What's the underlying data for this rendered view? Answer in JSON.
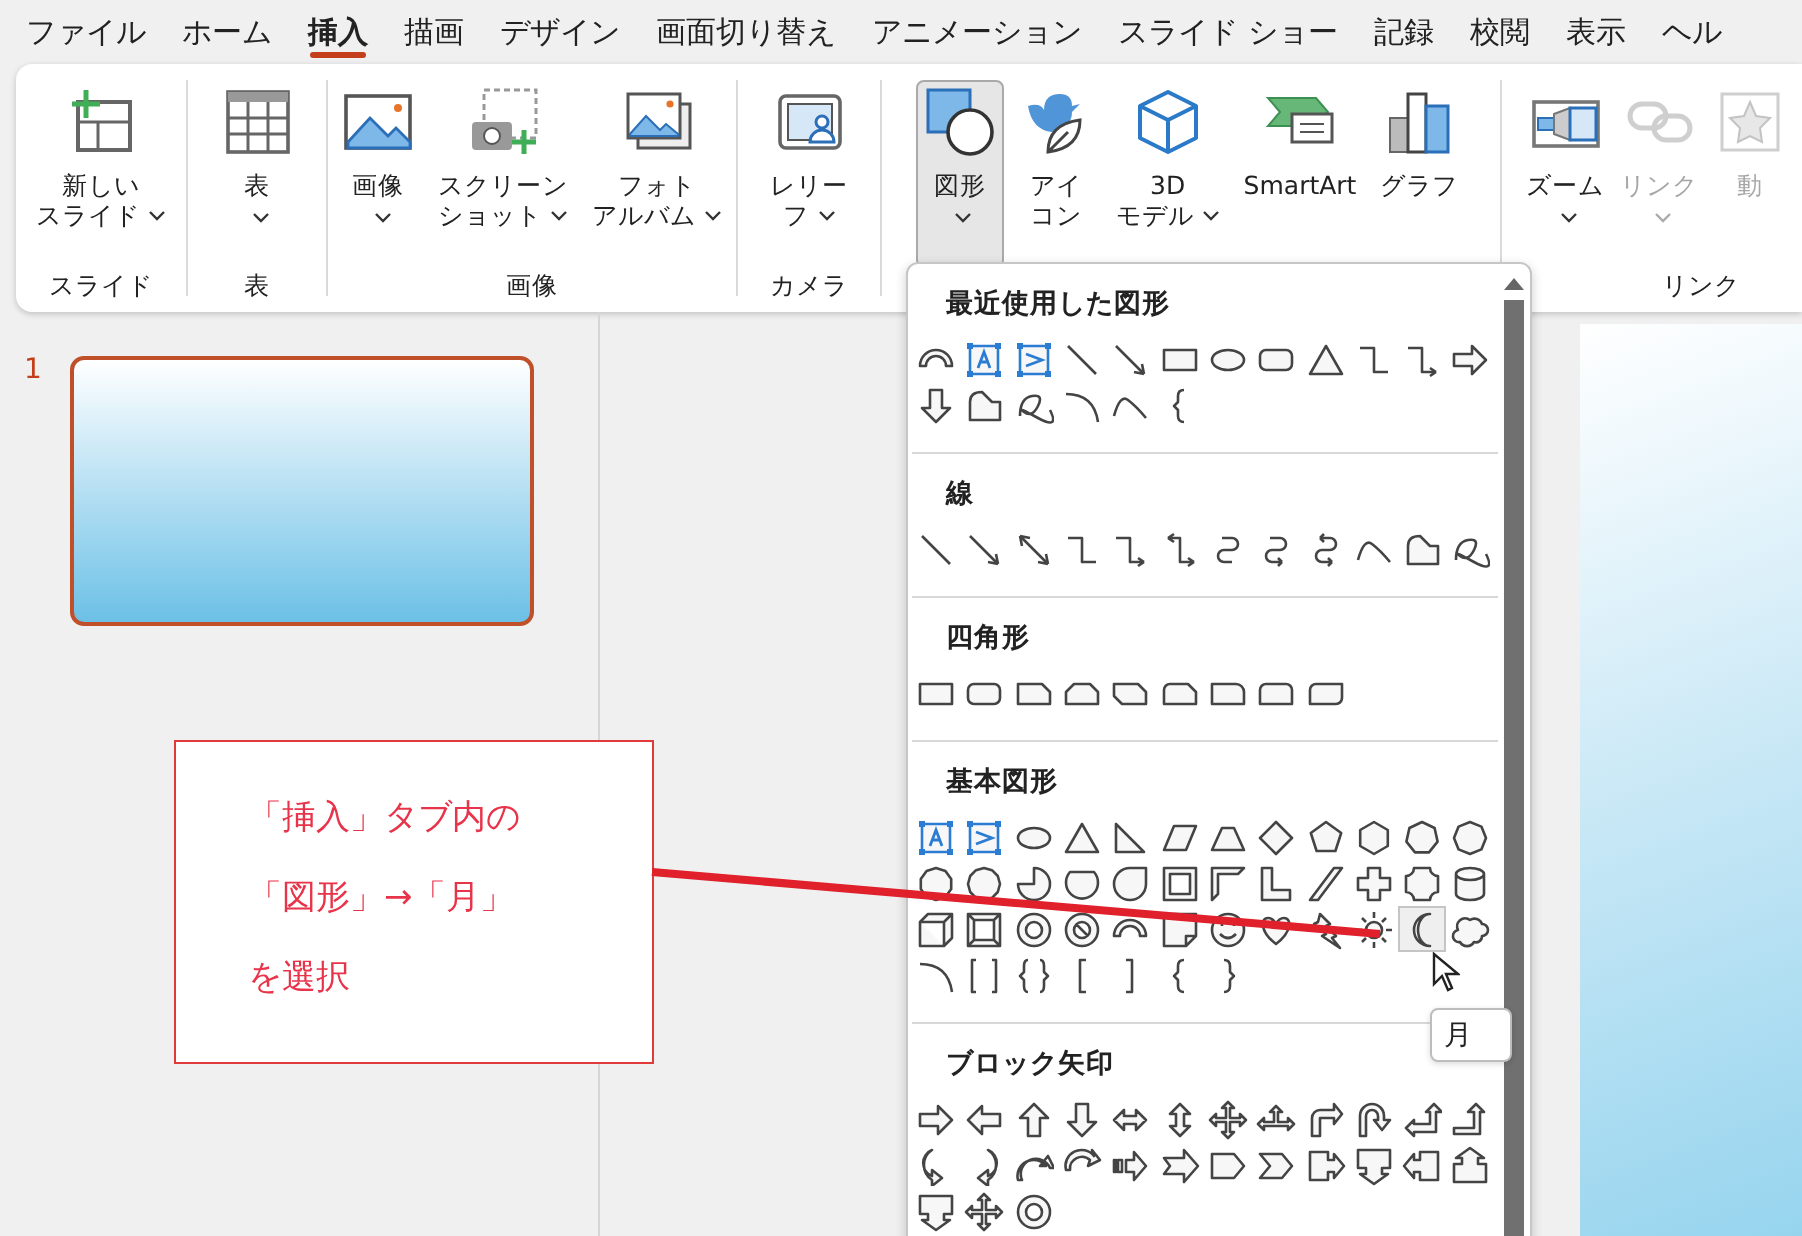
{
  "tabs": [
    {
      "label": "ファイル",
      "selected": false
    },
    {
      "label": "ホーム",
      "selected": false
    },
    {
      "label": "挿入",
      "selected": true
    },
    {
      "label": "描画",
      "selected": false
    },
    {
      "label": "デザイン",
      "selected": false
    },
    {
      "label": "画面切り替え",
      "selected": false
    },
    {
      "label": "アニメーション",
      "selected": false
    },
    {
      "label": "スライド ショー",
      "selected": false
    },
    {
      "label": "記録",
      "selected": false
    },
    {
      "label": "校閲",
      "selected": false
    },
    {
      "label": "表示",
      "selected": false
    },
    {
      "label": "ヘル",
      "selected": false
    }
  ],
  "ribbon": {
    "groups": [
      {
        "label": "スライド",
        "buttons": [
          {
            "lines": [
              "新しい",
              "スライド"
            ],
            "dropdown": true,
            "pressed": false,
            "disabled": false
          }
        ]
      },
      {
        "label": "表",
        "buttons": [
          {
            "lines": [
              "表"
            ],
            "dropdown": true,
            "pressed": false,
            "disabled": false
          }
        ]
      },
      {
        "label": "画像",
        "buttons": [
          {
            "lines": [
              "画像"
            ],
            "dropdown": true,
            "pressed": false,
            "disabled": false
          },
          {
            "lines": [
              "スクリーン",
              "ショット"
            ],
            "dropdown": true,
            "pressed": false,
            "disabled": false
          },
          {
            "lines": [
              "フォト",
              "アルバム"
            ],
            "dropdown": true,
            "pressed": false,
            "disabled": false
          }
        ]
      },
      {
        "label": "カメラ",
        "buttons": [
          {
            "lines": [
              "レリー",
              "フ"
            ],
            "dropdown": true,
            "pressed": false,
            "disabled": false
          }
        ]
      },
      {
        "buttons": [
          {
            "lines": [
              "図形"
            ],
            "dropdown": true,
            "pressed": true,
            "disabled": false
          },
          {
            "lines": [
              "アイ",
              "コン"
            ],
            "dropdown": false,
            "pressed": false,
            "disabled": false
          },
          {
            "lines": [
              "3D",
              "モデル"
            ],
            "dropdown": true,
            "pressed": false,
            "disabled": false
          },
          {
            "lines": [
              "SmartArt"
            ],
            "dropdown": false,
            "pressed": false,
            "disabled": false
          },
          {
            "lines": [
              "グラフ"
            ],
            "dropdown": false,
            "pressed": false,
            "disabled": false
          }
        ]
      },
      {
        "label": "リンク",
        "buttons": [
          {
            "lines": [
              "ズーム"
            ],
            "dropdown": true,
            "pressed": false,
            "disabled": false
          },
          {
            "lines": [
              "リンク"
            ],
            "dropdown": true,
            "pressed": false,
            "disabled": true
          },
          {
            "lines": [
              "動"
            ],
            "dropdown": false,
            "pressed": false,
            "disabled": true
          }
        ]
      }
    ]
  },
  "slides": [
    {
      "number": "1",
      "selected": true
    }
  ],
  "callout": {
    "lines": [
      "「挿入」タブ内の",
      "「図形」→「月」",
      "を選択"
    ]
  },
  "gallery": {
    "sections": [
      {
        "title": "最近使用した図形",
        "shapes": [
          {
            "kind": "block-arc",
            "selected": false
          },
          {
            "kind": "text-box",
            "selected": false
          },
          {
            "kind": "vertical-text-box",
            "selected": false
          },
          {
            "kind": "line",
            "selected": false
          },
          {
            "kind": "arrow-line",
            "selected": false
          },
          {
            "kind": "rectangle",
            "selected": false
          },
          {
            "kind": "oval",
            "selected": false
          },
          {
            "kind": "rounded-rectangle",
            "selected": false
          },
          {
            "kind": "triangle",
            "selected": false
          },
          {
            "kind": "elbow-connector",
            "selected": false
          },
          {
            "kind": "elbow-arrow",
            "selected": false
          },
          {
            "kind": "right-arrow",
            "selected": false
          },
          {
            "kind": "down-arrow",
            "selected": false
          },
          {
            "kind": "freeform",
            "selected": false
          },
          {
            "kind": "scribble",
            "selected": false
          },
          {
            "kind": "arc",
            "selected": false
          },
          {
            "kind": "curve",
            "selected": false
          },
          {
            "kind": "left-brace",
            "selected": false
          }
        ]
      },
      {
        "title": "線",
        "shapes": [
          {
            "kind": "line",
            "selected": false
          },
          {
            "kind": "arrow-line",
            "selected": false
          },
          {
            "kind": "double-arrow-line",
            "selected": false
          },
          {
            "kind": "elbow-connector",
            "selected": false
          },
          {
            "kind": "elbow-arrow",
            "selected": false
          },
          {
            "kind": "elbow-double-arrow",
            "selected": false
          },
          {
            "kind": "curved-connector",
            "selected": false
          },
          {
            "kind": "curved-arrow-connector",
            "selected": false
          },
          {
            "kind": "curved-double-arrow-connector",
            "selected": false
          },
          {
            "kind": "curve",
            "selected": false
          },
          {
            "kind": "freeform",
            "selected": false
          },
          {
            "kind": "scribble",
            "selected": false
          }
        ]
      },
      {
        "title": "四角形",
        "shapes": [
          {
            "kind": "rectangle",
            "selected": false
          },
          {
            "kind": "rounded-rectangle",
            "selected": false
          },
          {
            "kind": "snip-corner",
            "selected": false
          },
          {
            "kind": "snip-same-side",
            "selected": false
          },
          {
            "kind": "snip-diagonal",
            "selected": false
          },
          {
            "kind": "snip-round",
            "selected": false
          },
          {
            "kind": "round-corner",
            "selected": false
          },
          {
            "kind": "round-same-side",
            "selected": false
          },
          {
            "kind": "round-diagonal",
            "selected": false
          }
        ]
      },
      {
        "title": "基本図形",
        "shapes": [
          {
            "kind": "text-box",
            "selected": false
          },
          {
            "kind": "vertical-text-box",
            "selected": false
          },
          {
            "kind": "oval",
            "selected": false
          },
          {
            "kind": "triangle",
            "selected": false
          },
          {
            "kind": "right-triangle",
            "selected": false
          },
          {
            "kind": "parallelogram",
            "selected": false
          },
          {
            "kind": "trapezoid",
            "selected": false
          },
          {
            "kind": "diamond",
            "selected": false
          },
          {
            "kind": "pentagon",
            "selected": false
          },
          {
            "kind": "hexagon",
            "selected": false
          },
          {
            "kind": "heptagon",
            "selected": false
          },
          {
            "kind": "octagon",
            "selected": false
          },
          {
            "kind": "decagon",
            "selected": false
          },
          {
            "kind": "dodecagon",
            "selected": false
          },
          {
            "kind": "pie",
            "selected": false
          },
          {
            "kind": "chord",
            "selected": false
          },
          {
            "kind": "teardrop",
            "selected": false
          },
          {
            "kind": "frame",
            "selected": false
          },
          {
            "kind": "half-frame",
            "selected": false
          },
          {
            "kind": "l-shape",
            "selected": false
          },
          {
            "kind": "diagonal-stripe",
            "selected": false
          },
          {
            "kind": "cross",
            "selected": false
          },
          {
            "kind": "plaque",
            "selected": false
          },
          {
            "kind": "can",
            "selected": false
          },
          {
            "kind": "cube",
            "selected": false
          },
          {
            "kind": "bevel",
            "selected": false
          },
          {
            "kind": "donut",
            "selected": false
          },
          {
            "kind": "no-symbol",
            "selected": false
          },
          {
            "kind": "block-arc",
            "selected": false
          },
          {
            "kind": "folded-corner",
            "selected": false
          },
          {
            "kind": "smiley",
            "selected": false
          },
          {
            "kind": "heart",
            "selected": false
          },
          {
            "kind": "lightning",
            "selected": false
          },
          {
            "kind": "sun",
            "selected": false
          },
          {
            "kind": "moon",
            "selected": true
          },
          {
            "kind": "cloud",
            "selected": false
          },
          {
            "kind": "arc",
            "selected": false
          },
          {
            "kind": "bracket-pair",
            "selected": false
          },
          {
            "kind": "brace-pair",
            "selected": false
          },
          {
            "kind": "left-bracket",
            "selected": false
          },
          {
            "kind": "right-bracket",
            "selected": false
          },
          {
            "kind": "left-brace",
            "selected": false
          },
          {
            "kind": "right-brace",
            "selected": false
          }
        ]
      },
      {
        "title": "ブロック矢印",
        "shapes": [
          {
            "kind": "right-arrow",
            "selected": false
          },
          {
            "kind": "left-arrow",
            "selected": false
          },
          {
            "kind": "up-arrow",
            "selected": false
          },
          {
            "kind": "down-arrow",
            "selected": false
          },
          {
            "kind": "left-right-arrow",
            "selected": false
          },
          {
            "kind": "up-down-arrow",
            "selected": false
          },
          {
            "kind": "quad-arrow",
            "selected": false
          },
          {
            "kind": "left-right-up-arrow",
            "selected": false
          },
          {
            "kind": "bent-arrow",
            "selected": false
          },
          {
            "kind": "u-turn-arrow",
            "selected": false
          },
          {
            "kind": "left-up-arrow",
            "selected": false
          },
          {
            "kind": "bent-up-arrow",
            "selected": false
          },
          {
            "kind": "curved-right-arrow",
            "selected": false
          },
          {
            "kind": "curved-left-arrow",
            "selected": false
          },
          {
            "kind": "curved-up-arrow",
            "selected": false
          },
          {
            "kind": "curved-down-arrow",
            "selected": false
          },
          {
            "kind": "striped-right-arrow",
            "selected": false
          },
          {
            "kind": "notched-right-arrow",
            "selected": false
          },
          {
            "kind": "pentagon-arrow",
            "selected": false
          },
          {
            "kind": "chevron",
            "selected": false
          },
          {
            "kind": "right-arrow-callout",
            "selected": false
          },
          {
            "kind": "down-arrow-callout",
            "selected": false
          },
          {
            "kind": "left-arrow-callout",
            "selected": false
          },
          {
            "kind": "up-arrow-callout",
            "selected": false
          },
          {
            "kind": "down-arrow-callout",
            "selected": false
          },
          {
            "kind": "quad-arrow",
            "selected": false
          },
          {
            "kind": "donut",
            "selected": false
          }
        ]
      }
    ]
  },
  "tooltip": "月"
}
